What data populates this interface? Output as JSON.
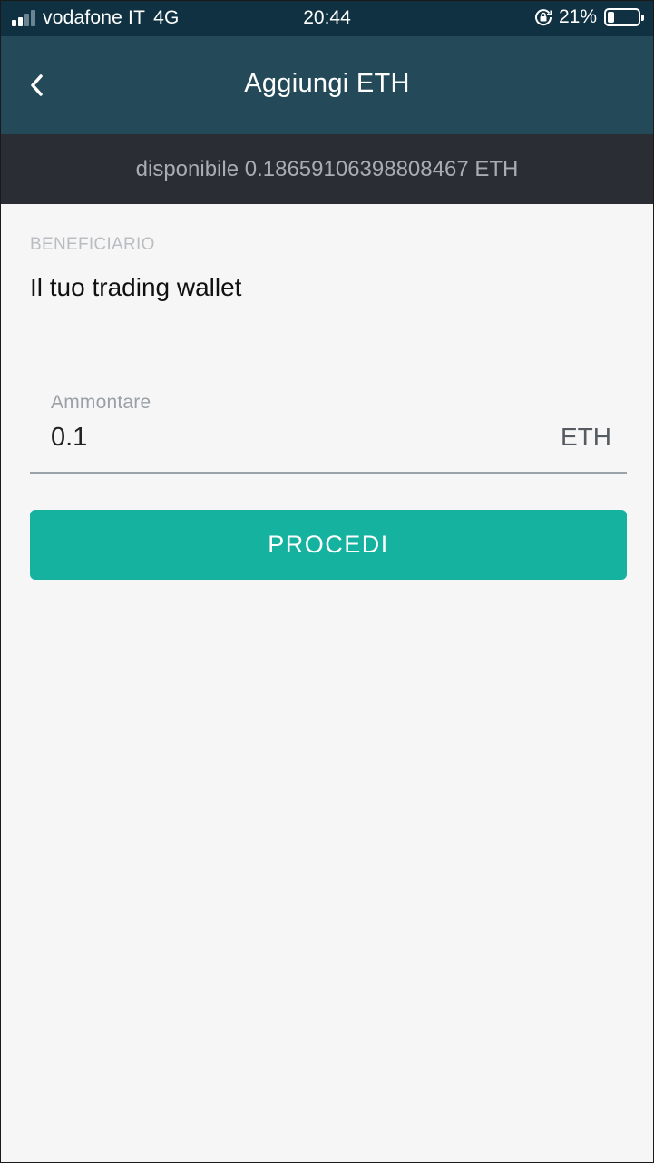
{
  "status_bar": {
    "carrier": "vodafone IT",
    "network": "4G",
    "time": "20:44",
    "battery_percent": "21%",
    "battery_level": 0.21
  },
  "header": {
    "title": "Aggiungi ETH",
    "back_icon": "chevron-left-icon"
  },
  "available": {
    "text": "disponibile 0.18659106398808467 ETH"
  },
  "beneficiary": {
    "label": "BENEFICIARIO",
    "value": "Il tuo trading wallet"
  },
  "amount": {
    "label": "Ammontare",
    "value": "0.1",
    "unit": "ETH"
  },
  "proceed_button": {
    "label": "PROCEDI"
  },
  "colors": {
    "status_bar": "#0f3142",
    "header": "#244959",
    "available_bar": "#2a2e34",
    "accent": "#14b29f",
    "background": "#f6f6f6"
  }
}
